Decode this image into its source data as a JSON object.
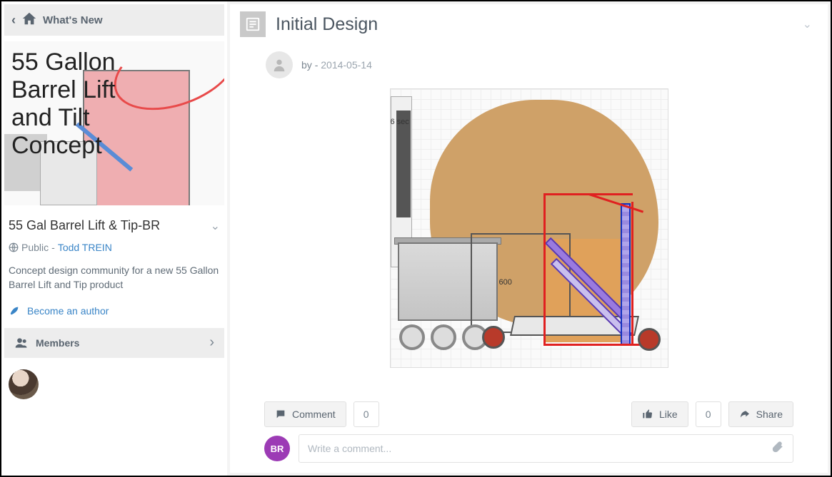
{
  "sidebar": {
    "whats_new_label": "What's New",
    "cover_text_lines": [
      "55 Gallon",
      "Barrel Lift",
      "and Tilt",
      "Concept"
    ],
    "community_title": "55 Gal Barrel Lift & Tip-BR",
    "visibility": "Public",
    "owner_prefix": " - ",
    "owner_name": "Todd TREIN",
    "description": "Concept design community for a new 55 Gallon Barrel Lift and Tip product",
    "become_author": "Become an author",
    "members_label": "Members"
  },
  "post": {
    "title": "Initial Design",
    "by_label": "by ",
    "author": "",
    "date_sep": " - ",
    "date": "2014-05-14",
    "design_labels": {
      "dim1": "600",
      "timecode": "6 sec"
    }
  },
  "actions": {
    "comment_label": "Comment",
    "comment_count": "0",
    "like_label": "Like",
    "like_count": "0",
    "share_label": "Share"
  },
  "comment_box": {
    "avatar_initials": "BR",
    "placeholder": "Write a comment..."
  }
}
